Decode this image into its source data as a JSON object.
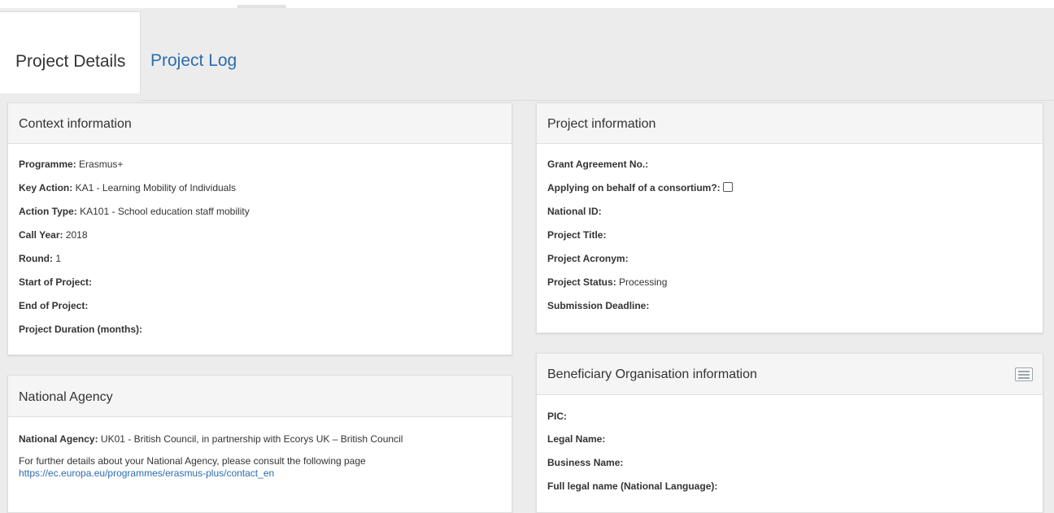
{
  "tabs": [
    {
      "label": "Project Details",
      "active": true
    },
    {
      "label": "Project Log",
      "active": false
    }
  ],
  "context": {
    "title": "Context information",
    "rows": [
      {
        "label": "Programme:",
        "value": "Erasmus+"
      },
      {
        "label": "Key Action:",
        "value": "KA1 - Learning Mobility of Individuals"
      },
      {
        "label": "Action Type:",
        "value": "KA101 - School education staff mobility"
      },
      {
        "label": "Call Year:",
        "value": "2018"
      },
      {
        "label": "Round:",
        "value": "1"
      },
      {
        "label": "Start of Project:",
        "value": ""
      },
      {
        "label": "End of Project:",
        "value": ""
      },
      {
        "label": "Project Duration (months):",
        "value": ""
      }
    ]
  },
  "national_agency": {
    "title": "National Agency",
    "label": "National Agency:",
    "value": "UK01 - British Council, in partnership with Ecorys UK – British Council",
    "note": "For further details about your National Agency, please consult the following page",
    "link": "https://ec.europa.eu/programmes/erasmus-plus/contact_en"
  },
  "project_info": {
    "title": "Project information",
    "grant_agreement": "Grant Agreement No.:",
    "consortium": "Applying on behalf of a consortium?:",
    "consortium_checked": false,
    "national_id": "National ID:",
    "project_title": "Project Title:",
    "project_acronym": "Project Acronym:",
    "status_label": "Project Status:",
    "status_value": "Processing",
    "submission_deadline": "Submission Deadline:"
  },
  "beneficiary": {
    "title": "Beneficiary Organisation information",
    "icon": "list-icon",
    "rows": [
      "PIC:",
      "Legal Name:",
      "Business Name:",
      "Full legal name (National Language):"
    ]
  },
  "colors": {
    "link": "#2c6cb0",
    "background": "#ececec",
    "panel_header": "#f5f5f5"
  }
}
